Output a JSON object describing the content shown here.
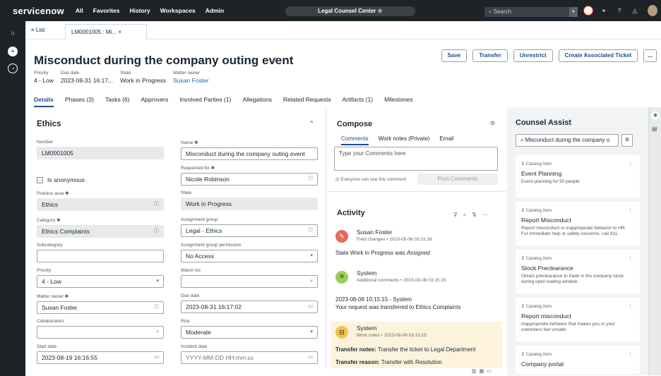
{
  "topnav": {
    "logo": "servicenow",
    "menu": [
      "All",
      "Favorites",
      "History",
      "Workspaces",
      "Admin"
    ],
    "context": "Legal Counsel Center ☆",
    "search_placeholder": "Search"
  },
  "tabs": {
    "list_label": "≡ List",
    "record_tab": "LM0001005 : Mi... ×"
  },
  "header": {
    "title": "Misconduct during the company outing event",
    "buttons": [
      "Save",
      "Transfer",
      "Unrestrict",
      "Create Associated Ticket",
      "..."
    ],
    "meta": [
      {
        "label": "Priority",
        "value": "4 - Low"
      },
      {
        "label": "Due date",
        "value": "2023-08-31 16:17..."
      },
      {
        "label": "State",
        "value": "Work in Progress"
      },
      {
        "label": "Matter owner",
        "value": "Susan Foster"
      }
    ],
    "record_tabs": [
      "Details",
      "Phases (3)",
      "Tasks (6)",
      "Approvers",
      "Involved Parties (1)",
      "Allegations",
      "Related Requests",
      "Artifacts (1)",
      "Milestones"
    ]
  },
  "form": {
    "section": "Ethics",
    "number": {
      "label": "Number",
      "value": "LM0001005"
    },
    "name": {
      "label": "Name ✱",
      "value": "Misconduct during the company outing event"
    },
    "requested_for": {
      "label": "Requested for ✱",
      "value": "Nicole Robinson"
    },
    "anonymous": "Is anonymous",
    "practice_area": {
      "label": "Practice area ✱",
      "value": "Ethics"
    },
    "state": {
      "label": "State",
      "value": "Work in Progress"
    },
    "category": {
      "label": "Category ✱",
      "value": "Ethics Complaints"
    },
    "assignment_group": {
      "label": "Assignment group",
      "value": "Legal - Ethics"
    },
    "subcategory": {
      "label": "Subcategory",
      "value": ""
    },
    "agp": {
      "label": "Assignment group permission",
      "value": "No Access"
    },
    "priority": {
      "label": "Priority",
      "value": "4 - Low"
    },
    "watch_list": {
      "label": "Watch list",
      "value": ""
    },
    "matter_owner": {
      "label": "Matter owner ✱",
      "value": "Susan Foster"
    },
    "due_date": {
      "label": "Due date",
      "value": "2023-08-31 16:17:02"
    },
    "collaborators": {
      "label": "Collaborators",
      "value": ""
    },
    "risk": {
      "label": "Risk",
      "value": "Moderate"
    },
    "start_date": {
      "label": "Start date",
      "value": "2023-08-19 16:16:55"
    },
    "incident_date": {
      "label": "Incident date",
      "value": "YYYY-MM-DD HH:mm:ss"
    }
  },
  "compose": {
    "title": "Compose",
    "tabs": [
      "Comments",
      "Work notes (Private)",
      "Email"
    ],
    "placeholder": "Type your Comments here",
    "visibility": "Everyone can see this comment",
    "post": "Post Comments"
  },
  "activity": {
    "title": "Activity",
    "e1_name": "Susan Foster",
    "e1_sub": "Field changes • 2023-08-08 03:31:26",
    "e1_text_pre": "State",
    "e1_text_val": "Work in Progress was",
    "e1_text_old": "Assigned",
    "e2_name": "System",
    "e2_sub": "Additional comments • 2023-08-08 03:15:15",
    "e2_line1": "2023-08-08 10:15:15 - System",
    "e2_line2": "Your request was transferred to Ethics Complaints",
    "e3_name": "System",
    "e3_sub": "Work notes • 2023-08-08 03:15:15",
    "e3_notes_label": "Transfer notes:",
    "e3_notes": "Transfer the ticket to Legal Department",
    "e3_reason_label": "Transfer reason:",
    "e3_reason": "Transfer with Resolution"
  },
  "counsel": {
    "title": "Counsel Assist",
    "search": "Misconduct during the company o",
    "cards": [
      {
        "cat": "Catalog Item",
        "title": "Event Planning",
        "desc": "Event planning for 50 people"
      },
      {
        "cat": "Catalog Item",
        "title": "Report Misconduct",
        "desc": "Report misconduct or inappropriate behavior to HR. For immediate help or safety concerns, call 911."
      },
      {
        "cat": "Catalog Item",
        "title": "Stock Preclearance",
        "desc": "Obtain preclearance to trade in the company stock during open trading window"
      },
      {
        "cat": "Catalog Item",
        "title": "Report misconduct",
        "desc": "Inappropriate behavior that makes you or your coworkers feel unsafe"
      },
      {
        "cat": "Catalog Item",
        "title": "Company portal",
        "desc": ""
      }
    ]
  },
  "colors": {
    "nav": "#1d2327",
    "accent": "#1f4e8c",
    "highlight": "#fdf3dc"
  }
}
